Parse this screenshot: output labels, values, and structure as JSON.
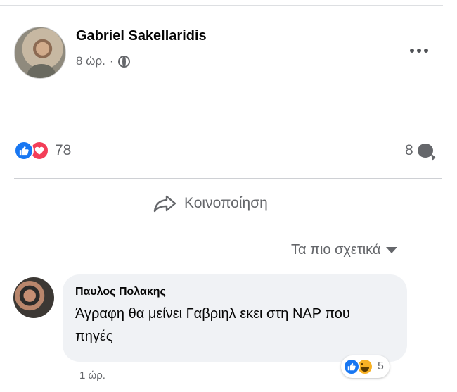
{
  "post": {
    "author": "Gabriel Sakellaridis",
    "time": "8 ώρ.",
    "separator": "·",
    "privacy_icon": "globe-icon",
    "more_icon": "more-options-icon"
  },
  "stats": {
    "reaction_icons": [
      "like-icon",
      "love-icon"
    ],
    "reaction_count": "78",
    "comment_count": "8"
  },
  "actions": {
    "share_label": "Κοινοποίηση"
  },
  "sort": {
    "label": "Τα πιο σχετικά"
  },
  "comment": {
    "author": "Παυλος Πολακης",
    "text": "Άγραφη θα μείνει Γαβριηλ εκει στη ΝΑΡ που πηγές",
    "time": "1 ώρ.",
    "reaction_icons": [
      "like-icon",
      "haha-icon"
    ],
    "reaction_count": "5"
  },
  "colors": {
    "like": "#1877f2",
    "love": "#f33e58",
    "haha": "#f7b125",
    "secondary_text": "#65676b",
    "comment_bg": "#f0f2f5"
  }
}
